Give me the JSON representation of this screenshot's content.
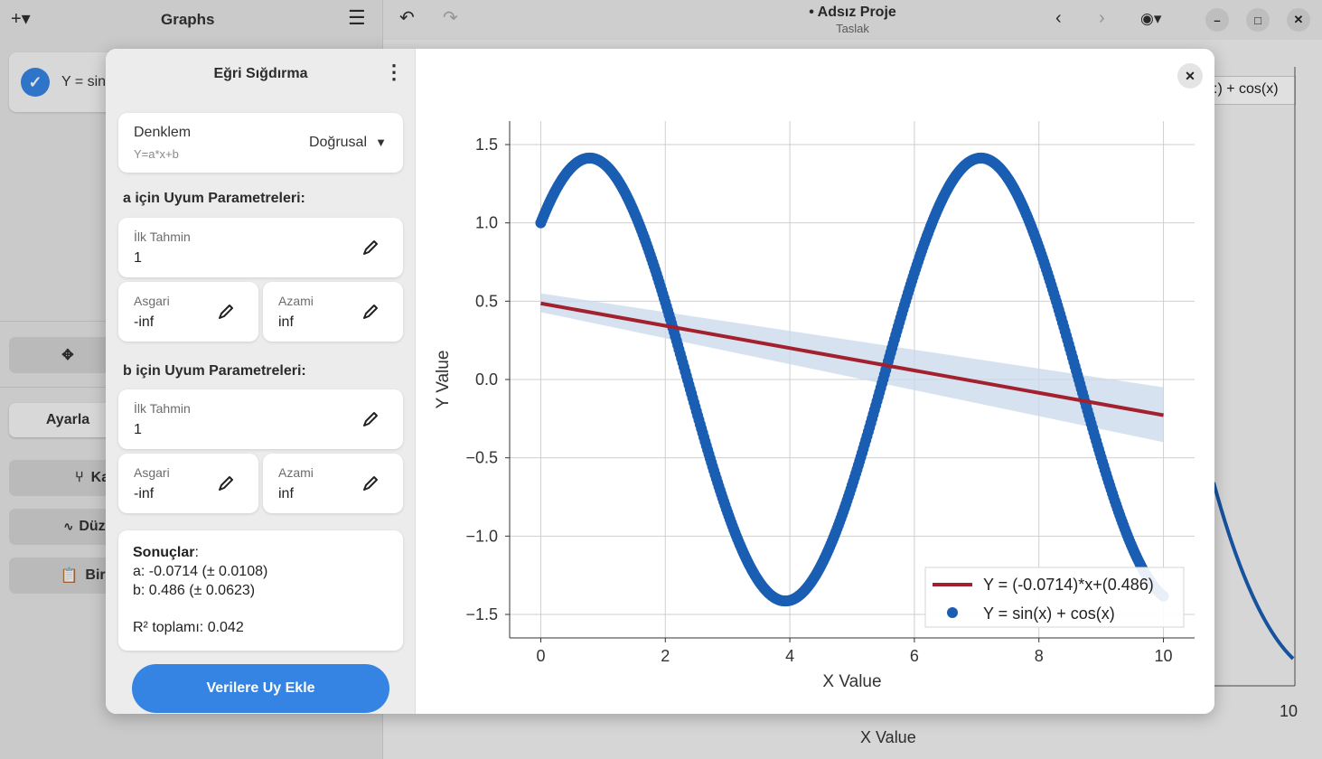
{
  "app": {
    "sidebar_title": "Graphs",
    "project_title": "• Adsız Proje",
    "project_subtitle": "Taslak",
    "item_label": "Y = sin",
    "bg_button_adjust": "Ayarla",
    "bg_button_1": "Kay",
    "bg_button_2": "Düzle",
    "bg_button_3": "Birle",
    "bg_legend_partial": ":) + cos(x)",
    "bg_x_label": "X Value",
    "bg_x_tick": "10"
  },
  "dialog": {
    "title": "Eğri Sığdırma",
    "equation_label": "Denklem",
    "equation_formula": "Y=a*x+b",
    "equation_type": "Doğrusal",
    "a_section": "a için Uyum Parametreleri:",
    "b_section": "b için Uyum Parametreleri:",
    "initial_guess_label": "İlk Tahmin",
    "min_label": "Asgari",
    "max_label": "Azami",
    "a_initial": "1",
    "a_min": "-inf",
    "a_max": "inf",
    "b_initial": "1",
    "b_min": "-inf",
    "b_max": "inf",
    "results_title": "Sonuçlar",
    "result_a": "a: -0.0714 (± 0.0108)",
    "result_b": "b: 0.486 (± 0.0623)",
    "r_squared": "R² toplamı: 0.042",
    "apply_button": "Verilere Uy Ekle"
  },
  "chart_data": {
    "type": "line",
    "xlabel": "X Value",
    "ylabel": "Y Value",
    "xlim": [
      -0.5,
      10.5
    ],
    "ylim": [
      -1.5,
      1.5
    ],
    "x_ticks": [
      0,
      2,
      4,
      6,
      8,
      10
    ],
    "y_ticks": [
      1.5,
      1.0,
      0.5,
      0.0,
      -0.5,
      -1.0,
      -1.5
    ],
    "y_tick_labels": [
      "1.5",
      "1.0",
      "0.5",
      "0.0",
      "−0.5",
      "−1.0",
      "−1.5"
    ],
    "grid": true,
    "legend_position": "bottom-right",
    "series": [
      {
        "name": "Y = (-0.0714)*x+(0.486)",
        "kind": "line",
        "slope": -0.0714,
        "intercept": 0.486,
        "x_range": [
          0,
          10
        ],
        "color": "#a3202f",
        "band_lower_at_x0": 0.43,
        "band_upper_at_x0": 0.55,
        "band_lower_at_x10": -0.4,
        "band_upper_at_x10": -0.05,
        "band_color": "#c9d8ec"
      },
      {
        "name": "Y = sin(x) + cos(x)",
        "kind": "scatter",
        "formula": "sin(x)+cos(x)",
        "x_range": [
          0,
          10
        ],
        "color": "#1a5eb3"
      }
    ]
  }
}
